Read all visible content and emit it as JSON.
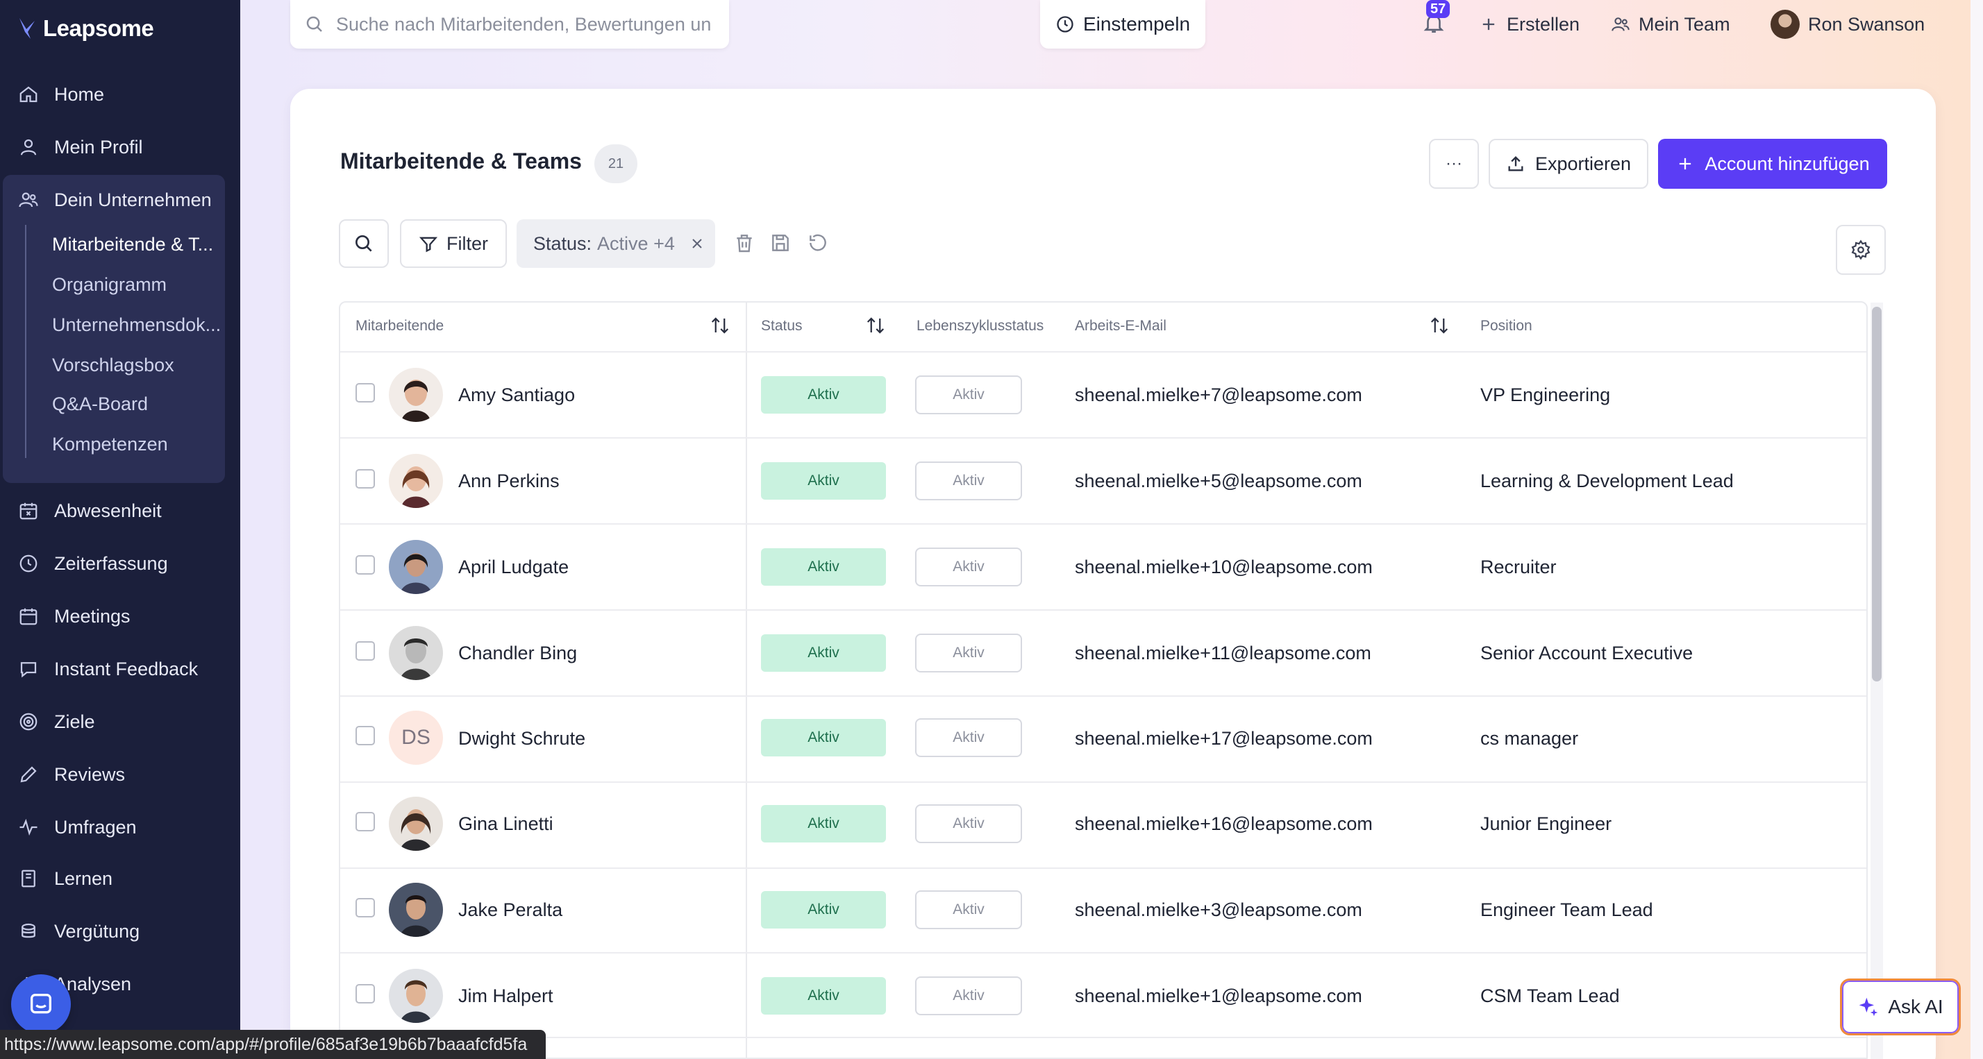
{
  "brand": {
    "name": "Leapsome"
  },
  "sidebar": {
    "items": [
      {
        "label": "Home",
        "icon": "home-icon"
      },
      {
        "label": "Mein Profil",
        "icon": "user-icon"
      },
      {
        "label": "Dein Unternehmen",
        "icon": "users-icon"
      },
      {
        "label": "Abwesenheit",
        "icon": "calendar-x-icon"
      },
      {
        "label": "Zeiterfassung",
        "icon": "clock-icon"
      },
      {
        "label": "Meetings",
        "icon": "calendar-icon"
      },
      {
        "label": "Instant Feedback",
        "icon": "chat-icon"
      },
      {
        "label": "Ziele",
        "icon": "target-icon"
      },
      {
        "label": "Reviews",
        "icon": "pen-icon"
      },
      {
        "label": "Umfragen",
        "icon": "pulse-icon"
      },
      {
        "label": "Lernen",
        "icon": "book-icon"
      },
      {
        "label": "Vergütung",
        "icon": "coins-icon"
      },
      {
        "label": "Analysen",
        "icon": "chart-icon"
      }
    ],
    "company_sub": [
      "Mitarbeitende & T...",
      "Organigramm",
      "Unternehmensdok...",
      "Vorschlagsbox",
      "Q&A-Board",
      "Kompetenzen"
    ]
  },
  "topbar": {
    "search_placeholder": "Suche nach Mitarbeitenden, Bewertungen un",
    "clock_in_label": "Einstempeln",
    "notifications_count": "57",
    "create_label": "Erstellen",
    "my_team_label": "Mein Team",
    "user_name": "Ron Swanson"
  },
  "page": {
    "title": "Mitarbeitende & Teams",
    "count": "21",
    "more_label": "···",
    "export_label": "Exportieren",
    "add_account_label": "Account hinzufügen",
    "filter_label": "Filter",
    "status_chip_key": "Status:",
    "status_chip_value": "Active +4"
  },
  "table": {
    "headers": {
      "employee": "Mitarbeitende",
      "status": "Status",
      "lifecycle": "Lebenszyklusstatus",
      "email": "Arbeits-E-Mail",
      "position": "Position"
    },
    "rows": [
      {
        "name": "Amy Santiago",
        "status": "Aktiv",
        "lifecycle": "Aktiv",
        "email": "sheenal.mielke+7@leapsome.com",
        "position": "VP Engineering"
      },
      {
        "name": "Ann Perkins",
        "status": "Aktiv",
        "lifecycle": "Aktiv",
        "email": "sheenal.mielke+5@leapsome.com",
        "position": "Learning & Development Lead"
      },
      {
        "name": "April Ludgate",
        "status": "Aktiv",
        "lifecycle": "Aktiv",
        "email": "sheenal.mielke+10@leapsome.com",
        "position": "Recruiter"
      },
      {
        "name": "Chandler Bing",
        "status": "Aktiv",
        "lifecycle": "Aktiv",
        "email": "sheenal.mielke+11@leapsome.com",
        "position": "Senior Account Executive"
      },
      {
        "name": "Dwight Schrute",
        "initials": "DS",
        "status": "Aktiv",
        "lifecycle": "Aktiv",
        "email": "sheenal.mielke+17@leapsome.com",
        "position": "cs manager"
      },
      {
        "name": "Gina Linetti",
        "status": "Aktiv",
        "lifecycle": "Aktiv",
        "email": "sheenal.mielke+16@leapsome.com",
        "position": "Junior Engineer"
      },
      {
        "name": "Jake Peralta",
        "status": "Aktiv",
        "lifecycle": "Aktiv",
        "email": "sheenal.mielke+3@leapsome.com",
        "position": "Engineer Team Lead"
      },
      {
        "name": "Jim Halpert",
        "status": "Aktiv",
        "lifecycle": "Aktiv",
        "email": "sheenal.mielke+1@leapsome.com",
        "position": "CSM Team Lead"
      }
    ]
  },
  "floating": {
    "ask_ai_label": "Ask AI",
    "status_url": "https://www.leapsome.com/app/#/profile/685af3e19b6b7baaafcfd5fa"
  },
  "colors": {
    "sidebar_bg": "#1b1f3b",
    "accent": "#5b3df5",
    "status_green_bg": "#c9f2df",
    "status_green_text": "#1e6f4d"
  }
}
